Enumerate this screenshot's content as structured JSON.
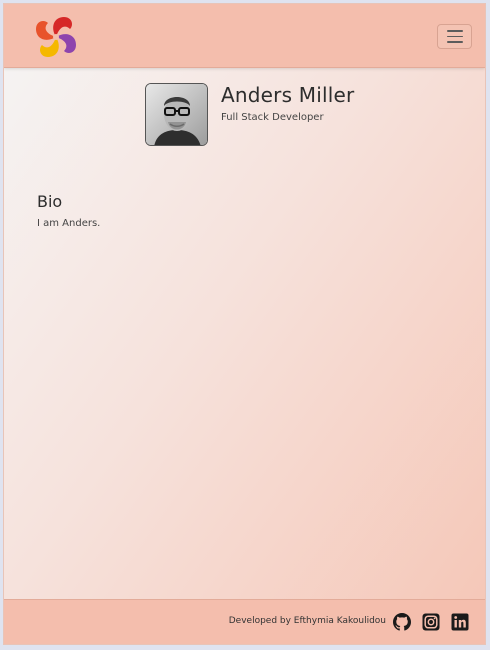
{
  "brand": {
    "logo_icon": "spiral-logo-icon"
  },
  "navbar": {
    "menu_icon": "hamburger-menu-icon"
  },
  "profile": {
    "name": "Anders Miller",
    "role": "Full Stack Developer",
    "avatar_icon": "profile-photo"
  },
  "bio": {
    "heading": "Bio",
    "text": "I am Anders."
  },
  "footer": {
    "credit": "Developed by Efthymia Kakoulidou",
    "social": [
      {
        "icon": "github-icon"
      },
      {
        "icon": "instagram-icon"
      },
      {
        "icon": "linkedin-icon"
      }
    ]
  },
  "colors": {
    "header_bg": "#f4bead",
    "accent_red": "#d62828",
    "accent_purple": "#8e44ad",
    "accent_yellow": "#f5b800"
  }
}
